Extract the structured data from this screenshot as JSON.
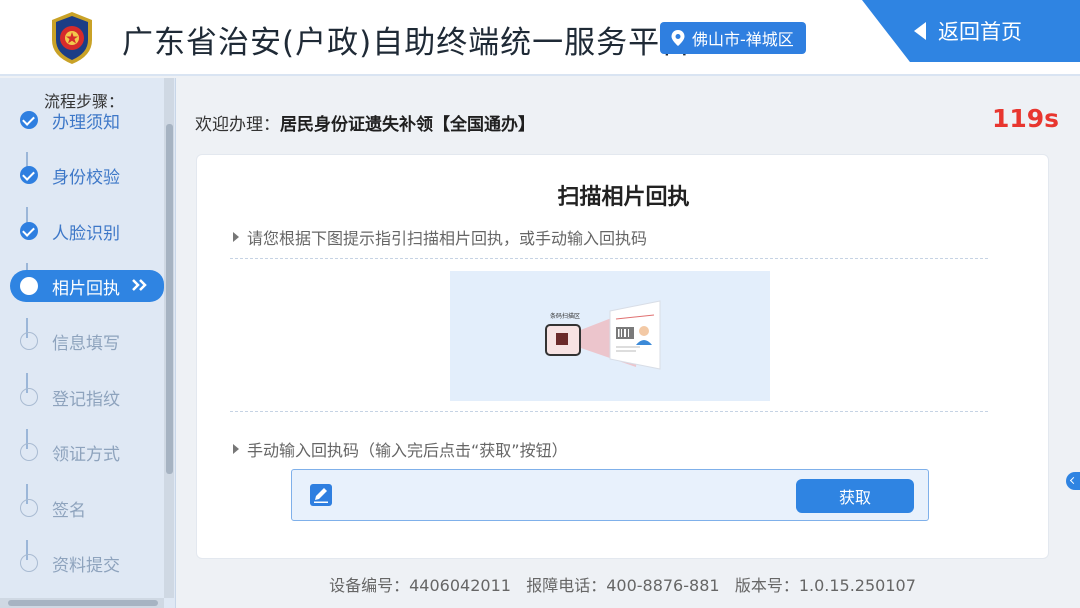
{
  "header": {
    "title": "广东省治安(户政)自助终端统一服务平台",
    "location": "佛山市-禅城区",
    "home_label": "返回首页"
  },
  "sidebar": {
    "title": "流程步骤：",
    "steps": [
      {
        "label": "办理须知",
        "state": "done"
      },
      {
        "label": "身份校验",
        "state": "done"
      },
      {
        "label": "人脸识别",
        "state": "done"
      },
      {
        "label": "相片回执",
        "state": "active"
      },
      {
        "label": "信息填写",
        "state": "todo"
      },
      {
        "label": "登记指纹",
        "state": "todo"
      },
      {
        "label": "领证方式",
        "state": "todo"
      },
      {
        "label": "签名",
        "state": "todo"
      },
      {
        "label": "资料提交",
        "state": "todo"
      }
    ]
  },
  "main": {
    "welcome_prefix": "欢迎办理：",
    "service_name": "居民身份证遗失补领【全国通办】",
    "countdown": "119s",
    "card_title": "扫描相片回执",
    "hint_scan": "请您根据下图提示指引扫描相片回执，或手动输入回执码",
    "illus_label": "条码扫描区",
    "hint_manual": "手动输入回执码（输入完后点击“获取”按钮）",
    "input_value": "",
    "get_button": "获取"
  },
  "footer": {
    "device_label": "设备编号：",
    "device_no": "4406042011",
    "phone_label": "报障电话：",
    "phone": "400-8876-881",
    "version_label": "版本号：",
    "version": "1.0.15.250107"
  },
  "colors": {
    "accent": "#2f84e2",
    "countdown": "#e8362f",
    "sidebar_bg": "#dfe8f4"
  }
}
